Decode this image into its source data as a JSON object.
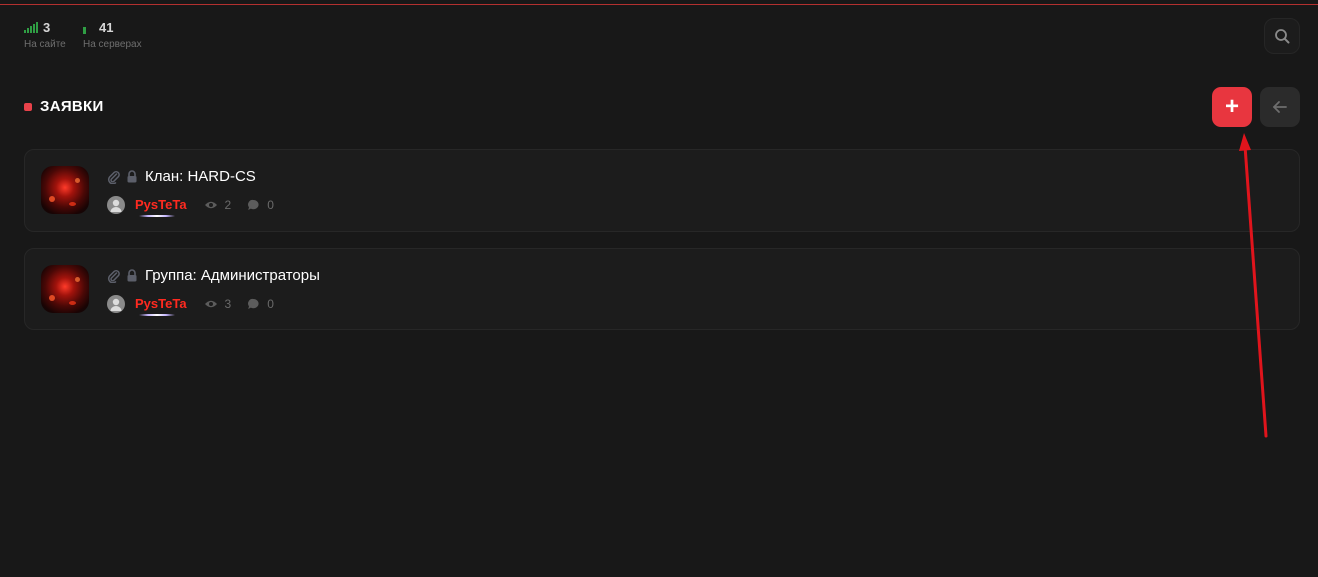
{
  "stats": {
    "online_count": "3",
    "online_label": "На сайте",
    "servers_count": "41",
    "servers_label": "На серверах"
  },
  "section": {
    "title": "ЗАЯВКИ"
  },
  "actions": {
    "add_label": "+"
  },
  "applications": [
    {
      "title": "Клан: HARD-CS",
      "author": "PysTeTa",
      "views": "2",
      "comments": "0"
    },
    {
      "title": "Группа: Администраторы",
      "author": "PysTeTa",
      "views": "3",
      "comments": "0"
    }
  ],
  "colors": {
    "accent": "#e8363f",
    "online_green": "#2f9e44",
    "author_red": "#ff2a20",
    "annotation_arrow": "#e0141c"
  },
  "icons": [
    "signal-icon",
    "search-icon",
    "plus-icon",
    "arrow-left-icon",
    "paperclip-icon",
    "lock-icon",
    "user-icon",
    "eye-icon",
    "comment-icon"
  ]
}
